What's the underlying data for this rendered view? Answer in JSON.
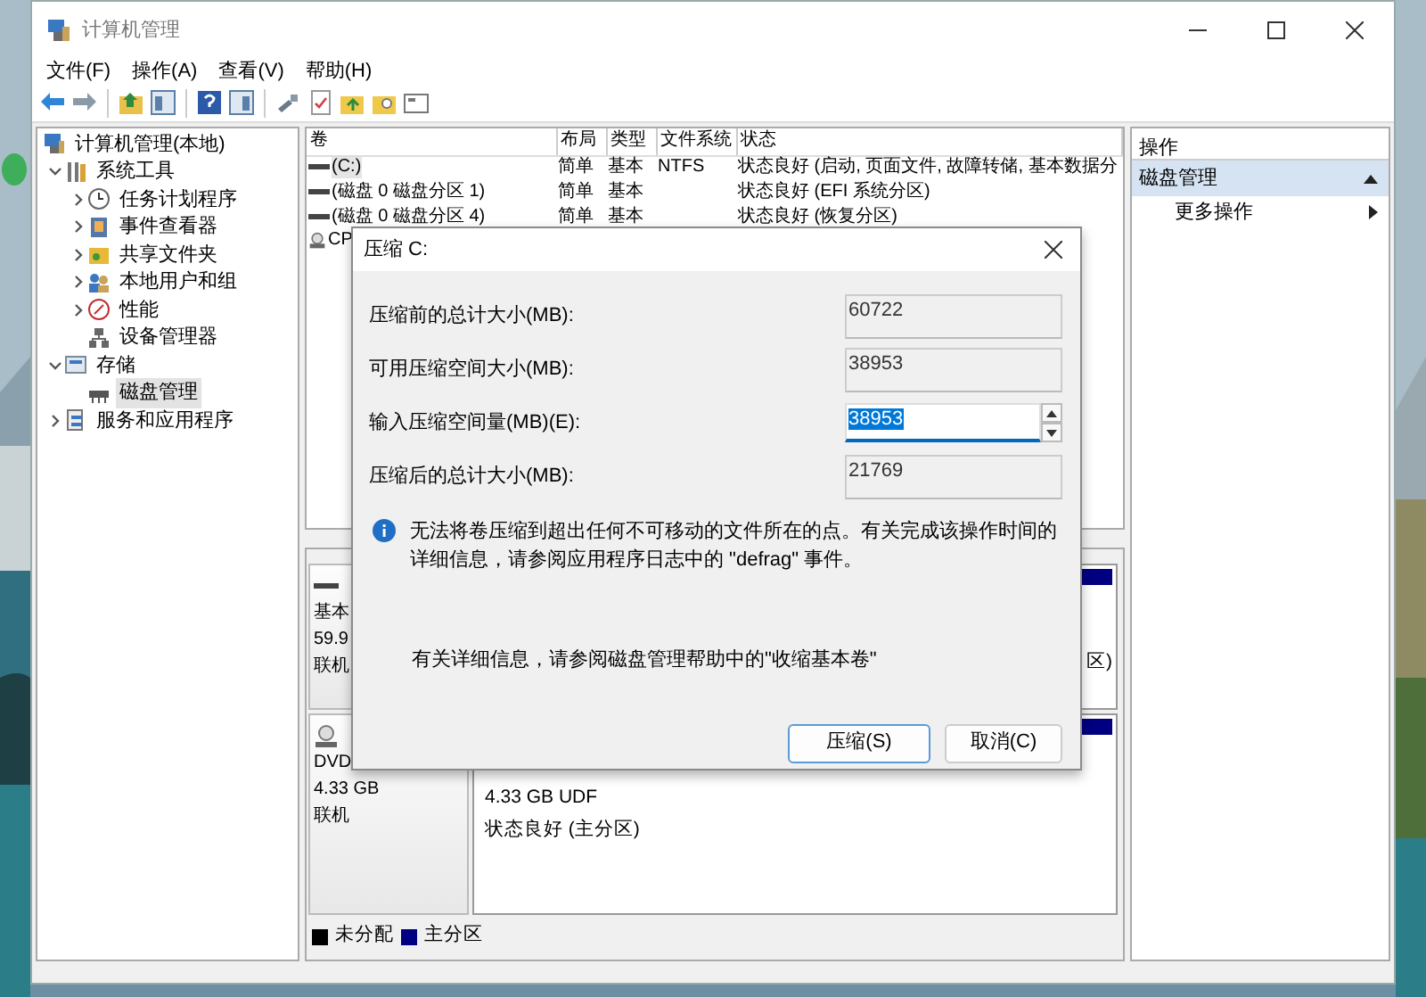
{
  "window": {
    "title": "计算机管理"
  },
  "menu": [
    {
      "label": "文件(F)"
    },
    {
      "label": "操作(A)"
    },
    {
      "label": "查看(V)"
    },
    {
      "label": "帮助(H)"
    }
  ],
  "tree": [
    {
      "label": "计算机管理(本地)",
      "selected": false,
      "children": [
        {
          "label": "系统工具",
          "selected": false,
          "expanded": true,
          "children": [
            {
              "label": "任务计划程序",
              "selected": false,
              "expanded": false
            },
            {
              "label": "事件查看器",
              "selected": false,
              "expanded": false
            },
            {
              "label": "共享文件夹",
              "selected": false,
              "expanded": false
            },
            {
              "label": "本地用户和组",
              "selected": false,
              "expanded": false
            },
            {
              "label": "性能",
              "selected": false,
              "expanded": false
            },
            {
              "label": "设备管理器",
              "selected": false
            }
          ]
        },
        {
          "label": "存储",
          "selected": false,
          "expanded": true,
          "children": [
            {
              "label": "磁盘管理",
              "selected": true
            }
          ]
        },
        {
          "label": "服务和应用程序",
          "selected": false,
          "expanded": false
        }
      ]
    }
  ],
  "volumes": {
    "columns": [
      "卷",
      "布局",
      "类型",
      "文件系统",
      "状态"
    ],
    "rows": [
      {
        "kind": "disk",
        "selected": true,
        "cells": [
          "(C:)",
          "简单",
          "基本",
          "NTFS",
          "状态良好 (启动, 页面文件, 故障转储, 基本数据分"
        ]
      },
      {
        "kind": "disk",
        "selected": false,
        "cells": [
          "(磁盘 0 磁盘分区 1)",
          "简单",
          "基本",
          "",
          "状态良好 (EFI 系统分区)"
        ]
      },
      {
        "kind": "disk",
        "selected": false,
        "cells": [
          "(磁盘 0 磁盘分区 4)",
          "简单",
          "基本",
          "",
          "状态良好 (恢复分区)"
        ]
      },
      {
        "kind": "cdrom",
        "selected": false,
        "cells": [
          "CP"
        ]
      }
    ]
  },
  "disks": [
    {
      "kind": "disk",
      "lines": [
        "基本",
        "59.9",
        "联机"
      ],
      "partition": {
        "lines": [
          "区)"
        ]
      }
    },
    {
      "kind": "cdrom",
      "lines": [
        "DVD",
        "4.33 GB",
        "联机"
      ],
      "partition": {
        "lines": [
          "4.33 GB UDF",
          "状态良好 (主分区)"
        ]
      }
    }
  ],
  "legend": [
    {
      "label": "未分配",
      "color": "#000000"
    },
    {
      "label": "主分区",
      "color": "#000080"
    }
  ],
  "actions": {
    "title": "操作",
    "groups": [
      {
        "label": "磁盘管理",
        "expanded": true,
        "items": [
          {
            "label": "更多操作"
          }
        ]
      }
    ]
  },
  "dialog": {
    "title": "压缩 C:",
    "fields": [
      {
        "kind": "readonly",
        "label": "压缩前的总计大小(MB):",
        "value": "60722"
      },
      {
        "kind": "readonly",
        "label": "可用压缩空间大小(MB):",
        "value": "38953"
      },
      {
        "kind": "spin",
        "label": "输入压缩空间量(MB)(E):",
        "value": "38953",
        "text_selected": true
      },
      {
        "kind": "readonly",
        "label": "压缩后的总计大小(MB):",
        "value": "21769"
      }
    ],
    "info": "无法将卷压缩到超出任何不可移动的文件所在的点。有关完成该操作时间的详细信息，请参阅应用程序日志中的 \"defrag\" 事件。",
    "help": "有关详细信息，请参阅磁盘管理帮助中的\"收缩基本卷\"",
    "buttons": [
      {
        "label": "压缩(S)",
        "default": true
      },
      {
        "label": "取消(C)",
        "default": false
      }
    ]
  }
}
